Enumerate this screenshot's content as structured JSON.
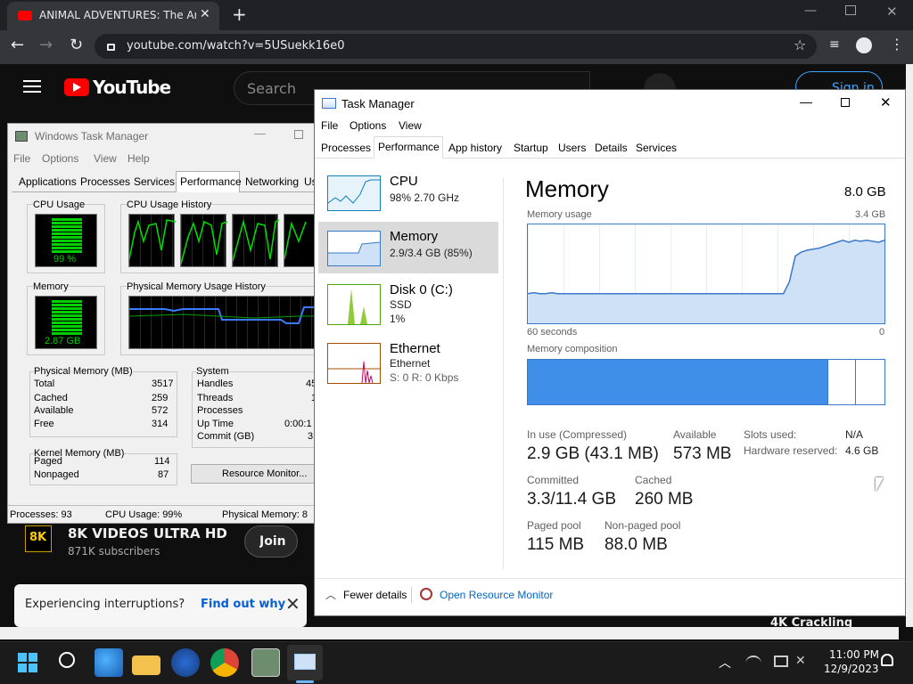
{
  "chrome": {
    "tab_title": "ANIMAL ADVENTURES: The Ama",
    "url": "youtube.com/watch?v=5USuekk16e0"
  },
  "youtube": {
    "logo": "YouTube",
    "search_placeholder": "Search",
    "sign_in": "Sign in",
    "channel_name": "8K VIDEOS ULTRA HD",
    "subscribers": "871K subscribers",
    "join": "Join",
    "interrupt_text": "Experiencing interruptions?",
    "find_out": "Find out why",
    "thumb_text": "4K Crackling",
    "channel_badge": "8K"
  },
  "old_tm": {
    "title": "Windows Task Manager",
    "menu": [
      "File",
      "Options",
      "View",
      "Help"
    ],
    "tabs": [
      "Applications",
      "Processes",
      "Services",
      "Performance",
      "Networking",
      "Us"
    ],
    "cpu_usage_label": "CPU Usage",
    "cpu_usage_value": "99 %",
    "cpu_history_label": "CPU Usage History",
    "memory_label": "Memory",
    "memory_value": "2.87 GB",
    "phys_history_label": "Physical Memory Usage History",
    "phys_mem": {
      "label": "Physical Memory (MB)",
      "rows": [
        [
          "Total",
          "3517"
        ],
        [
          "Cached",
          "259"
        ],
        [
          "Available",
          "572"
        ],
        [
          "Free",
          "314"
        ]
      ]
    },
    "system": {
      "label": "System",
      "rows": [
        [
          "Handles",
          "45"
        ],
        [
          "Threads",
          "1"
        ],
        [
          "Processes",
          ""
        ],
        [
          "Up Time",
          "0:00:1"
        ],
        [
          "Commit (GB)",
          "3"
        ]
      ]
    },
    "kernel": {
      "label": "Kernel Memory (MB)",
      "rows": [
        [
          "Paged",
          "114"
        ],
        [
          "Nonpaged",
          "87"
        ]
      ]
    },
    "resource_btn": "Resource Monitor...",
    "status": {
      "processes": "Processes: 93",
      "cpu": "CPU Usage: 99%",
      "phys": "Physical Memory: 8"
    }
  },
  "new_tm": {
    "title": "Task Manager",
    "menu": [
      "File",
      "Options",
      "View"
    ],
    "tabs": [
      "Processes",
      "Performance",
      "App history",
      "Startup",
      "Users",
      "Details",
      "Services"
    ],
    "side": [
      {
        "name": "CPU",
        "l1": "98%  2.70 GHz",
        "l2": ""
      },
      {
        "name": "Memory",
        "l1": "2.9/3.4 GB (85%)",
        "l2": ""
      },
      {
        "name": "Disk 0 (C:)",
        "l1": "SSD",
        "l2": "1%"
      },
      {
        "name": "Ethernet",
        "l1": "Ethernet",
        "l2": "S: 0  R: 0 Kbps"
      }
    ],
    "heading": "Memory",
    "total": "8.0 GB",
    "usage_label": "Memory usage",
    "usage_max": "3.4 GB",
    "time_left": "60 seconds",
    "time_right": "0",
    "composition_label": "Memory composition",
    "stats": {
      "inuse_label": "In use (Compressed)",
      "inuse_value": "2.9 GB (43.1 MB)",
      "available_label": "Available",
      "available_value": "573 MB",
      "slots_label": "Slots used:",
      "slots_value": "N/A",
      "hw_label": "Hardware reserved:",
      "hw_value": "4.6 GB",
      "committed_label": "Committed",
      "committed_value": "3.3/11.4 GB",
      "cached_label": "Cached",
      "cached_value": "260 MB",
      "paged_label": "Paged pool",
      "paged_value": "115 MB",
      "nonpaged_label": "Non-paged pool",
      "nonpaged_value": "88.0 MB"
    },
    "fewer": "Fewer details",
    "open_rm": "Open Resource Monitor",
    "usage_graph": [
      0.3,
      0.31,
      0.3,
      0.3,
      0.31,
      0.3,
      0.3,
      0.3,
      0.3,
      0.3,
      0.3,
      0.3,
      0.3,
      0.3,
      0.3,
      0.3,
      0.3,
      0.3,
      0.3,
      0.3,
      0.3,
      0.3,
      0.3,
      0.3,
      0.3,
      0.3,
      0.3,
      0.3,
      0.3,
      0.3,
      0.3,
      0.3,
      0.3,
      0.3,
      0.3,
      0.3,
      0.3,
      0.3,
      0.3,
      0.3,
      0.3,
      0.3,
      0.3,
      0.3,
      0.42,
      0.68,
      0.72,
      0.74,
      0.75,
      0.76,
      0.78,
      0.8,
      0.82,
      0.84,
      0.82,
      0.84,
      0.83,
      0.84,
      0.83,
      0.82,
      0.84
    ]
  },
  "taskbar": {
    "time": "11:00 PM",
    "date": "12/9/2023"
  },
  "colors": {
    "mem_fill": "#cfe1f7",
    "mem_line": "#3a78c9",
    "mem_block": "#3f8fe8",
    "lcd_green": "#00d000"
  }
}
